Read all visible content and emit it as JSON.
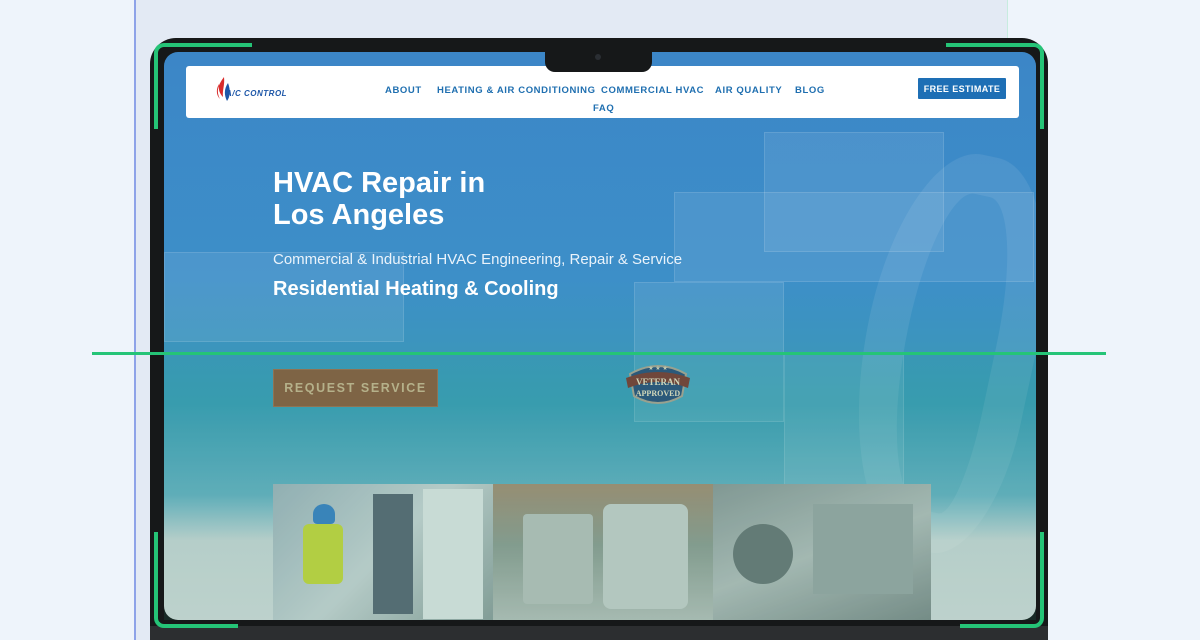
{
  "brand": {
    "logo_text": "A/C CONTROL"
  },
  "nav": {
    "items": [
      "ABOUT",
      "HEATING & AIR CONDITIONING",
      "COMMERCIAL HVAC",
      "AIR QUALITY",
      "BLOG",
      "FAQ"
    ],
    "cta": "FREE ESTIMATE"
  },
  "hero": {
    "title_line1": "HVAC Repair in",
    "title_line2": "Los Angeles",
    "subtitle": "Commercial & Industrial HVAC Engineering, Repair & Service",
    "subtitle2": "Residential Heating & Cooling",
    "cta": "REQUEST SERVICE"
  },
  "badge": {
    "line1": "VETERAN",
    "line2": "APPROVED"
  },
  "colors": {
    "accent": "#1e6fb5",
    "cta_brown": "#8a5a3c",
    "highlight_green": "#25c477"
  },
  "icons": [
    "flame-logo-icon",
    "veteran-approved-badge"
  ]
}
